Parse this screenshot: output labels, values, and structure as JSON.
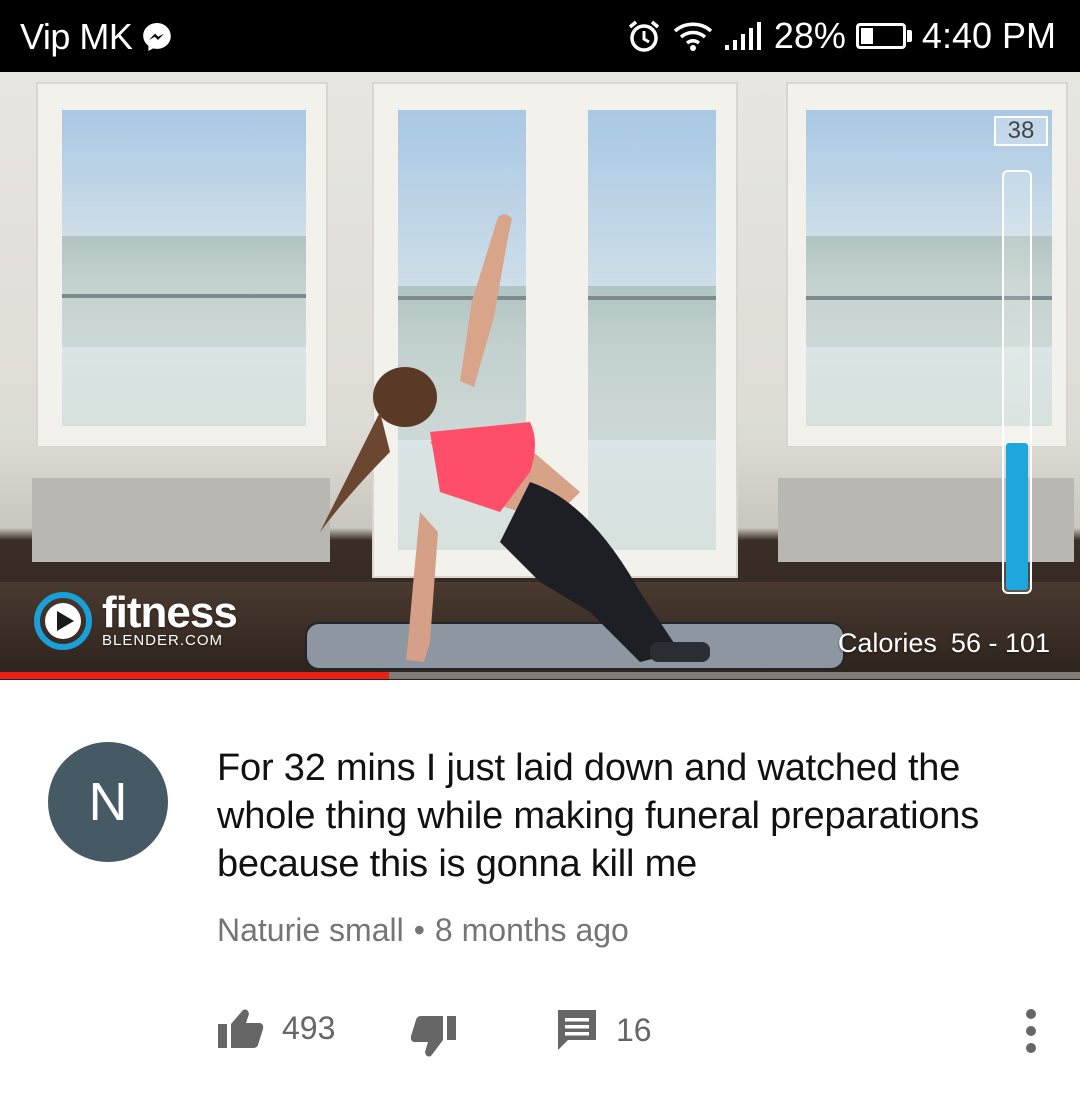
{
  "status_bar": {
    "carrier": "Vip MK",
    "battery": "28%",
    "battery_level": 0.28,
    "time": "4:40 PM",
    "icons": [
      "messenger-icon",
      "alarm-icon",
      "wifi-icon",
      "signal-icon",
      "battery-icon"
    ]
  },
  "video": {
    "logo_main": "fitness",
    "logo_sub": "BLENDER.COM",
    "timer": "38",
    "meter_level": 0.35,
    "calories_label": "Calories",
    "calories_value": "56 - 101",
    "progress": 0.36,
    "colors": {
      "progress": "#e62117",
      "meter": "#1ea7dc"
    }
  },
  "comment": {
    "avatar_letter": "N",
    "text": "For 32 mins I just laid down and watched the whole thing while making funeral preparations because this is gonna kill me",
    "author": "Naturie small",
    "separator": "•",
    "age": "8 months ago",
    "likes": "493",
    "replies": "16",
    "colors": {
      "avatar": "#455a64",
      "meta": "#757575"
    }
  }
}
